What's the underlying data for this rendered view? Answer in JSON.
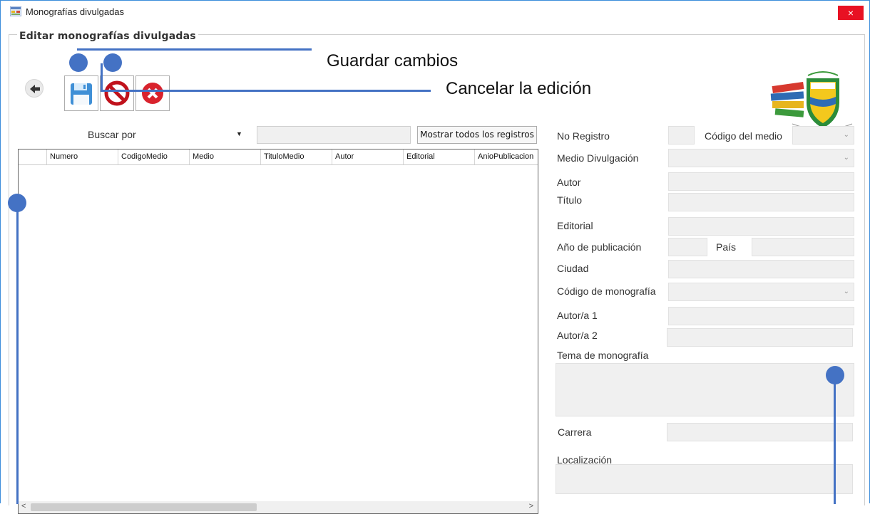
{
  "window": {
    "title": "Monografías divulgadas",
    "close_glyph": "×"
  },
  "group": {
    "title": "Editar monografías divulgadas"
  },
  "toolbar": {
    "back_icon": "arrow-left-icon",
    "save_icon": "floppy-disk-icon",
    "cancel_edit_icon": "prohibited-icon",
    "close_icon": "red-x-circle-icon"
  },
  "search": {
    "label": "Buscar por",
    "value": "",
    "show_all_label": "Mostrar todos los registros"
  },
  "grid": {
    "columns": [
      "Numero",
      "CodigoMedio",
      "Medio",
      "TituloMedio",
      "Autor",
      "Editorial",
      "AnioPublicacion"
    ],
    "rows": []
  },
  "form": {
    "no_registro": "No Registro",
    "codigo_medio": "Código del medio",
    "medio_divulgacion": "Medio Divulgación",
    "autor": "Autor",
    "titulo": "Título",
    "editorial": "Editorial",
    "anio_publicacion": "Año de publicación",
    "pais": "País",
    "ciudad": "Ciudad",
    "codigo_monografia": "Código de monografía",
    "autor1": "Autor/a 1",
    "autor2": "Autor/a 2",
    "tema_monografia": "Tema de monografía",
    "carrera": "Carrera",
    "localizacion": "Localización"
  },
  "callouts": {
    "guardar": "Guardar cambios",
    "cancelar": "Cancelar la edición"
  },
  "colors": {
    "callout": "#4472c4",
    "close": "#e81123",
    "field_bg": "#f0f0f0"
  }
}
